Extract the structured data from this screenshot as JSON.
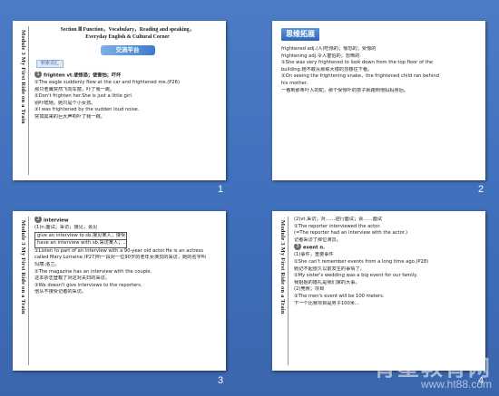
{
  "slides": [
    {
      "number": "1",
      "side_title": "Module 3  My First Ride on a Train",
      "header_lines": [
        "Section Ⅲ  Function，Vocabulary，Reading and speaking，",
        "Everyday English & Cultural Corner"
      ],
      "band_label": "交流平台",
      "tag": "积累词汇",
      "lines": [
        "frighten vt.使惊恐；使害怕；吓坏",
        "①The eagle suddenly flew at the car and frightened me.(P26)",
        "那只老鹰突然飞向车窗，吓了我一跳。",
        "②Don't frighten her.She is just a little girl.",
        "别吓唬她，她只是个小女孩。",
        "③I was frightened by the sudden loud noise.",
        "突如其来的巨大声响吓了我一跳。"
      ]
    },
    {
      "number": "2",
      "banner": "思维拓展",
      "lines": [
        "frightened adj.(人)吃惊的；惊恐的；受惊的",
        "frightening adj.令人害怕的；恐怖的",
        "①She was very frightened to look down from the top floor of the",
        "building.她不敢从那栋大楼的顶楼往下看。",
        "②On seeing the frightening snake，the frightened child ran behind",
        "his mother.",
        "一看到那条吓人的蛇，那个受惊吓的孩子就跑到他妈妈身后。"
      ]
    },
    {
      "number": "3",
      "side_title": "Module 3  My First Ride on a Train",
      "head": "interview",
      "lines_top": [
        "(1)n.面试；采访；接见；会见"
      ],
      "box_lines": [
        "give an interview to sb.接见某人；接受某人采访",
        "have an interview with sb.采访某人；..."
      ],
      "lines": [
        "①Listen to part of an interview with a 90-year old actor.He is an actress",
        "called Mary Lorraine.(P27)听一段对一位90岁的老年女演员的采访，她的名字叫",
        "玛丽·洛兰。",
        "②The magazine has an interview with the couple.",
        "这本杂志登载了对这对夫妇的采访。",
        "③We doesn't give interviews to the reporters.",
        "他从不接受记者的采访。"
      ]
    },
    {
      "number": "4",
      "side_title": "Module 3  My First Ride on a Train",
      "lines_top": [
        "(2)vt.采访；对……进行面试；会……面试",
        "①The reporter interviewed the actor.",
        "(=The reporter had an interview with the actor.)",
        "记者采访了那位演员。"
      ],
      "head": "event n.",
      "lines": [
        "(1)事件，重要事件",
        "①She can't remember events from a long time ago.(P28)",
        "她记不起很久以前发生的事情了。",
        "②My sister's wedding was a big event for our family.",
        "我姐姐的婚礼是我们家的大事。",
        "(2)竞赛；项目",
        "③The men's event will be 100 meters.",
        "下一个比赛项目是男子100米..."
      ]
    }
  ],
  "watermark": {
    "top": "育星教育网",
    "bottom": "www.ht88.com"
  }
}
